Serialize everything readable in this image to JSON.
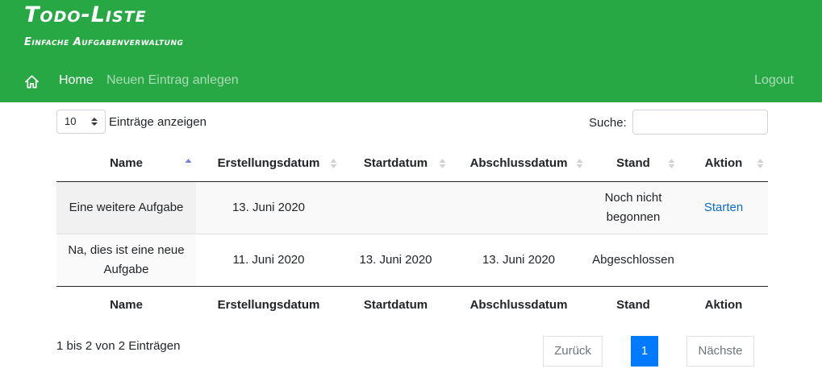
{
  "header": {
    "title": "Todo-Liste",
    "subtitle": "Einfache Aufgabenverwaltung",
    "home_icon": "home-icon",
    "nav": {
      "home": "Home",
      "new_entry": "Neuen Eintrag anlegen",
      "logout": "Logout"
    }
  },
  "colors": {
    "header_bg": "#28a745",
    "link": "#0a6ccb",
    "pagination_active": "#007bff"
  },
  "controls": {
    "length_value": "10",
    "length_label": "Einträge anzeigen",
    "search_label": "Suche:",
    "search_value": ""
  },
  "table": {
    "columns": [
      "Name",
      "Erstellungsdatum",
      "Startdatum",
      "Abschlussdatum",
      "Stand",
      "Aktion"
    ],
    "sorted_column": "Name",
    "sort_direction": "ascending",
    "rows": [
      {
        "name": "Eine weitere Aufgabe",
        "created": "13. Juni 2020",
        "start": "",
        "end": "",
        "status": "Noch nicht begonnen",
        "action": "Starten"
      },
      {
        "name": "Na, dies ist eine neue Aufgabe",
        "created": "11. Juni 2020",
        "start": "13. Juni 2020",
        "end": "13. Juni 2020",
        "status": "Abgeschlossen",
        "action": ""
      }
    ]
  },
  "footer": {
    "info": "1 bis 2 von 2 Einträgen",
    "pagination": {
      "previous": "Zurück",
      "current_page": "1",
      "next": "Nächste"
    }
  }
}
